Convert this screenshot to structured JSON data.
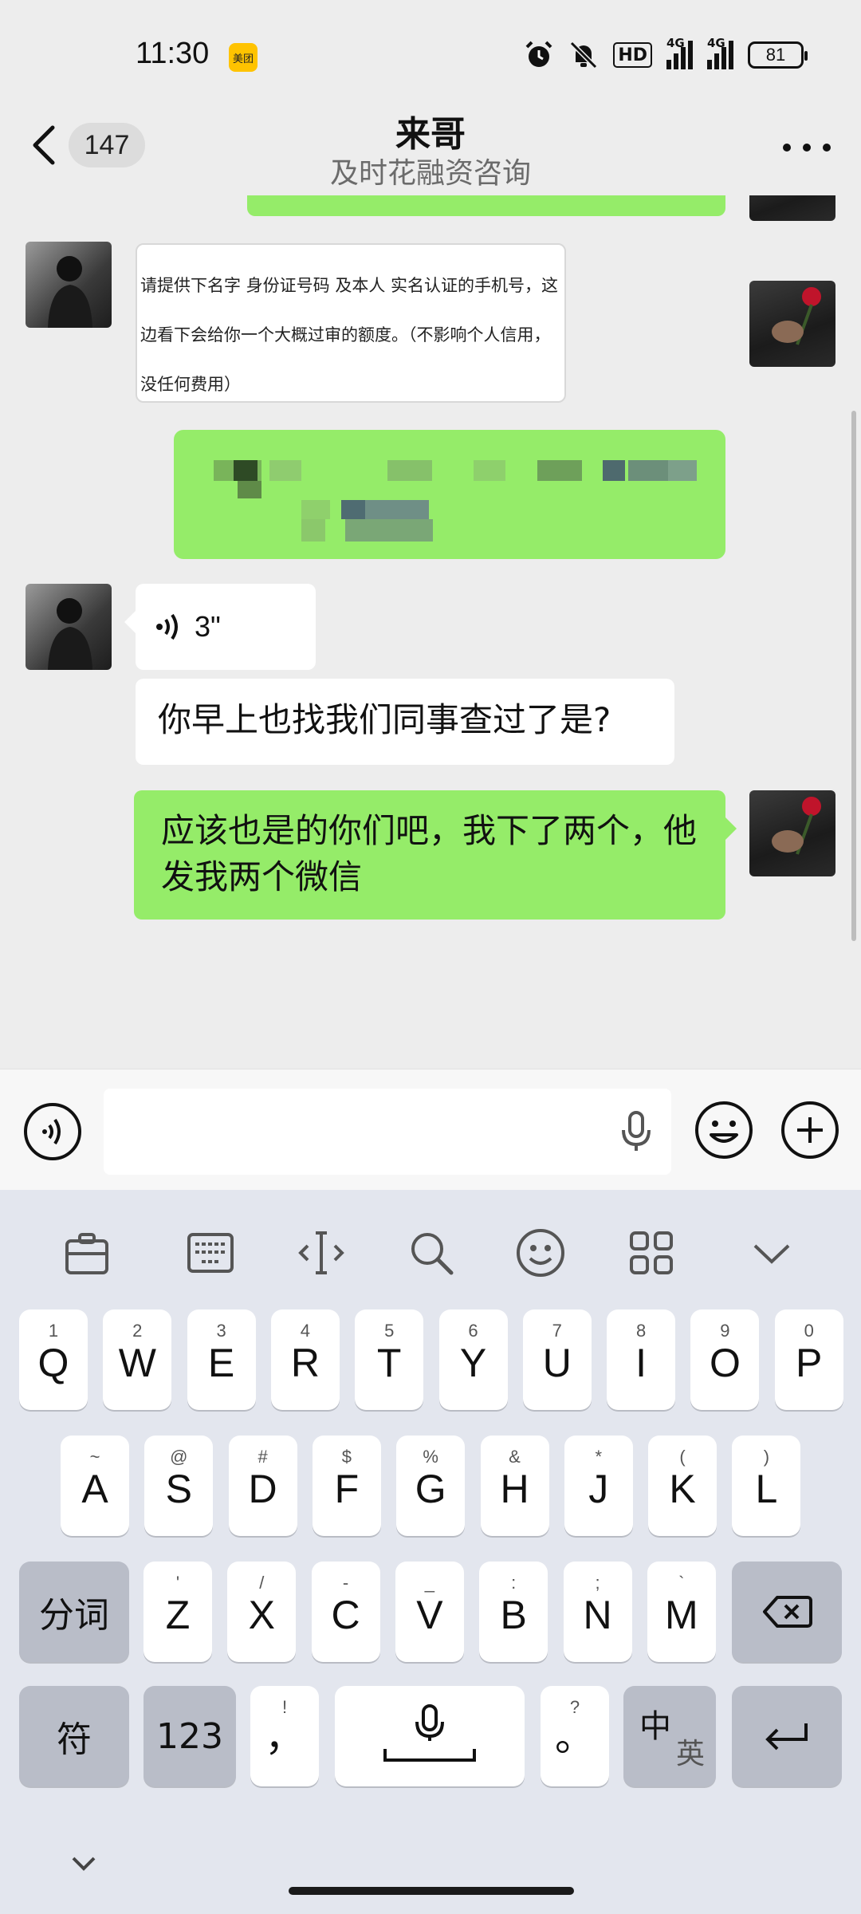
{
  "status_bar": {
    "time": "11:30",
    "app_badge": "美团",
    "hd_label": "HD",
    "signal_1_label": "4G",
    "signal_2_label": "4G",
    "battery": "81"
  },
  "nav": {
    "unread_count": "147",
    "title": "来哥",
    "subtitle": "及时花融资咨询"
  },
  "messages": {
    "image_text": "请提供下名字 身份证号码 及本人 实名认证的手机号，这边看下会给你一个大概过审的额度。（不影响个人信用，没任何费用）",
    "voice_duration": "3\"",
    "received_text": "你早上也找我们同事查过了是?",
    "sent_text": "应该也是的你们吧，我下了两个，他发我两个微信"
  },
  "keyboard": {
    "row1": [
      {
        "main": "Q",
        "sub": "1"
      },
      {
        "main": "W",
        "sub": "2"
      },
      {
        "main": "E",
        "sub": "3"
      },
      {
        "main": "R",
        "sub": "4"
      },
      {
        "main": "T",
        "sub": "5"
      },
      {
        "main": "Y",
        "sub": "6"
      },
      {
        "main": "U",
        "sub": "7"
      },
      {
        "main": "I",
        "sub": "8"
      },
      {
        "main": "O",
        "sub": "9"
      },
      {
        "main": "P",
        "sub": "0"
      }
    ],
    "row2": [
      {
        "main": "A",
        "sub": "~"
      },
      {
        "main": "S",
        "sub": "@"
      },
      {
        "main": "D",
        "sub": "#"
      },
      {
        "main": "F",
        "sub": "$"
      },
      {
        "main": "G",
        "sub": "%"
      },
      {
        "main": "H",
        "sub": "&"
      },
      {
        "main": "J",
        "sub": "*"
      },
      {
        "main": "K",
        "sub": "("
      },
      {
        "main": "L",
        "sub": ")"
      }
    ],
    "row3": [
      {
        "main": "Z",
        "sub": "'"
      },
      {
        "main": "X",
        "sub": "/"
      },
      {
        "main": "C",
        "sub": "-"
      },
      {
        "main": "V",
        "sub": "_"
      },
      {
        "main": "B",
        "sub": ":"
      },
      {
        "main": "N",
        "sub": ";"
      },
      {
        "main": "M",
        "sub": "`"
      }
    ],
    "segment_label": "分词",
    "symbol_label": "符",
    "numbers_label": "123",
    "comma": {
      "main": "，",
      "sub": "!"
    },
    "period": {
      "main": "。",
      "sub": "?"
    },
    "lang_main": "中",
    "lang_sub": "英"
  },
  "colors": {
    "sent_bubble": "#95ec69",
    "received_bubble": "#ffffff",
    "chat_background": "#ededed",
    "keyboard_background": "#e3e6ee"
  }
}
